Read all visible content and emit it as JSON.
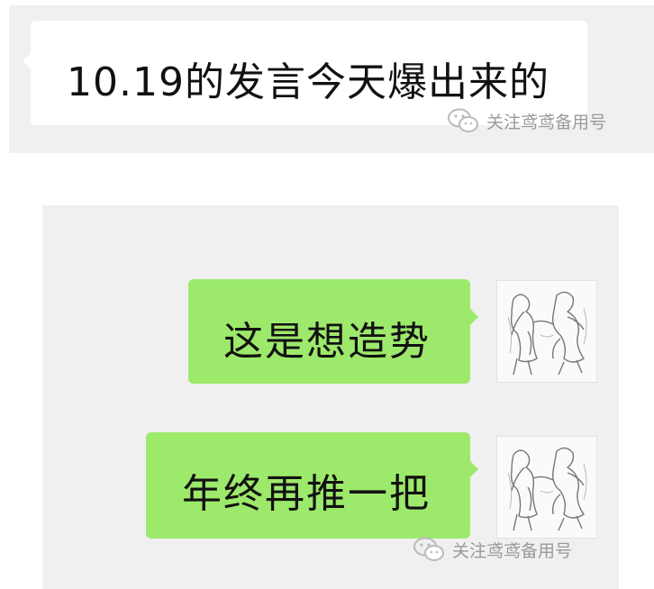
{
  "top_message": {
    "text": "10.19的发言今天爆出来的"
  },
  "conversation": {
    "messages": [
      {
        "text": "这是想造势",
        "side": "right",
        "bubble_color": "#9de96b"
      },
      {
        "text": "年终再推一把",
        "side": "right",
        "bubble_color": "#9de96b"
      }
    ]
  },
  "watermarks": {
    "top": {
      "text": "关注鸢鸢备用号",
      "icon": "wechat-icon"
    },
    "bottom": {
      "text": "关注鸢鸢备用号",
      "icon": "wechat-icon"
    }
  },
  "colors": {
    "panel_bg": "#f0f0f0",
    "incoming_bubble": "#ffffff",
    "outgoing_bubble": "#9de96b",
    "watermark_text": "#999999"
  }
}
